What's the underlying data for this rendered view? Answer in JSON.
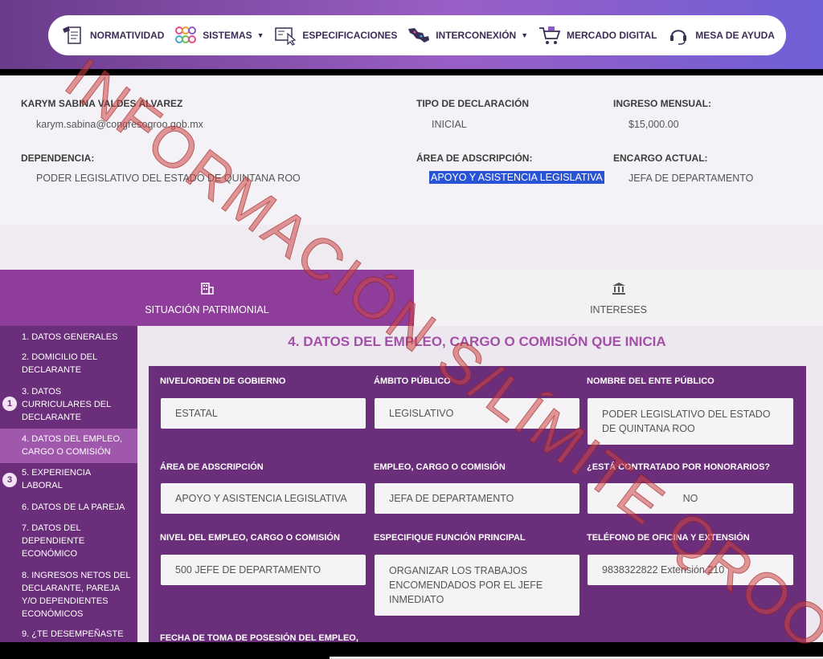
{
  "nav": {
    "items": [
      {
        "label": "NORMATIVIDAD",
        "icon": "law-document-icon",
        "dropdown": false
      },
      {
        "label": "SISTEMAS",
        "icon": "circles-grid-icon",
        "dropdown": true
      },
      {
        "label": "ESPECIFICACIONES",
        "icon": "pointer-document-icon",
        "dropdown": false
      },
      {
        "label": "INTERCONEXIÓN",
        "icon": "mexico-map-icon",
        "dropdown": true
      },
      {
        "label": "MERCADO DIGITAL",
        "icon": "shopping-cart-icon",
        "dropdown": false
      },
      {
        "label": "MESA DE AYUDA",
        "icon": "headset-icon",
        "dropdown": false
      }
    ]
  },
  "declarant": {
    "name": "KARYM SABINA VALDES ALVAREZ",
    "email": "karym.sabina@congresoqroo.gob.mx",
    "dependencia_label": "DEPENDENCIA:",
    "dependencia": "PODER LEGISLATIVO DEL ESTADO DE QUINTANA ROO",
    "tipo_label": "TIPO DE DECLARACIÓN",
    "tipo": "INICIAL",
    "area_label": "ÁREA DE ADSCRIPCIÓN:",
    "area": "APOYO Y ASISTENCIA LEGISLATIVA",
    "ingreso_label": "INGRESO MENSUAL:",
    "ingreso": "$15,000.00",
    "encargo_label": "ENCARGO ACTUAL:",
    "encargo": "JEFA DE DEPARTAMENTO"
  },
  "tabs": {
    "left": "SITUACIÓN PATRIMONIAL",
    "right": "INTERESES"
  },
  "sidebar": {
    "items": [
      "1. DATOS GENERALES",
      "2. DOMICILIO DEL DECLARANTE",
      "3. DATOS CURRICULARES DEL DECLARANTE",
      "4. DATOS DEL EMPLEO, CARGO O COMISIÓN",
      "5. EXPERIENCIA LABORAL",
      "6. DATOS DE LA PAREJA",
      "7. DATOS DEL DEPENDIENTE ECONÓMICO",
      "8. INGRESOS NETOS DEL DECLARANTE, PAREJA Y/O DEPENDIENTES ECONÓMICOS",
      "9. ¿TE DESEMPEÑASTE"
    ],
    "badges": [
      "1",
      "3"
    ]
  },
  "form": {
    "title": "4. DATOS DEL EMPLEO, CARGO O COMISIÓN QUE INICIA",
    "nivel_label": "NIVEL/ORDEN DE GOBIERNO",
    "nivel": "ESTATAL",
    "ambito_label": "ÁMBITO PÚBLICO",
    "ambito": "LEGISLATIVO",
    "ente_label": "NOMBRE DEL ENTE PÚBLICO",
    "ente": "PODER LEGISLATIVO DEL ESTADO DE QUINTANA ROO",
    "area_label": "ÁREA DE ADSCRIPCIÓN",
    "area": "APOYO Y ASISTENCIA LEGISLATIVA",
    "empleo_label": "EMPLEO, CARGO O COMISIÓN",
    "empleo": "JEFA DE DEPARTAMENTO",
    "honorarios_label": "¿ESTÁ CONTRATADO POR HONORARIOS?",
    "honorarios": "NO",
    "nivel_empleo_label": "NIVEL DEL EMPLEO, CARGO O COMISIÓN",
    "nivel_empleo": "500 JEFE DE DEPARTAMENTO",
    "funcion_label": "ESPECIFIQUE FUNCIÓN PRINCIPAL",
    "funcion": "ORGANIZAR LOS TRABAJOS ENCOMENDADOS POR EL JEFE INMEDIATO",
    "telefono_label": "TELÉFONO DE OFICINA Y EXTENSIÓN",
    "telefono": "9838322822 Extensión 210",
    "fecha_label": "FECHA DE TOMA DE POSESIÓN DEL EMPLEO,"
  },
  "watermark": "INFORMACIÓN S/LÍMITE QROO",
  "colors": {
    "primary_purple": "#6a2e7a",
    "tab_purple": "#8e3e9a",
    "title_purple": "#a34fa8",
    "watermark_red": "#cd4646",
    "highlight_blue": "#2a54d6"
  }
}
